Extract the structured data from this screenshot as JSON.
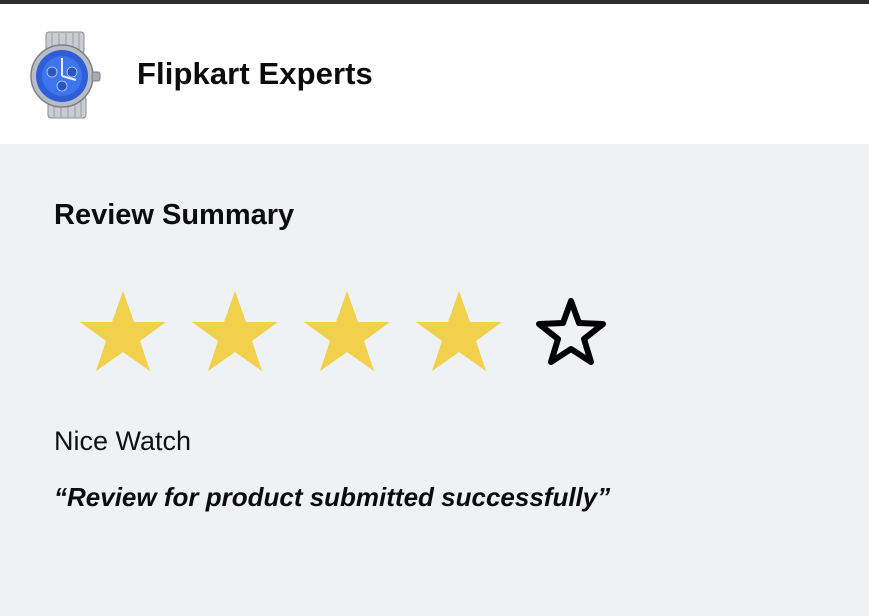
{
  "header": {
    "brand": "Flipkart Experts",
    "product_image": "watch-image"
  },
  "review": {
    "section_title": "Review Summary",
    "rating": 4,
    "max_rating": 5,
    "star_filled_color": "#f1d04b",
    "star_empty_color": "#000000",
    "title": "Nice Watch",
    "status_message": "“Review for product submitted successfully”"
  }
}
